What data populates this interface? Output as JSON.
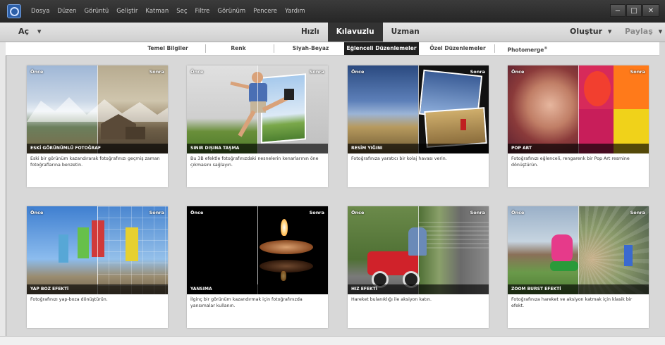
{
  "menubar": {
    "items": [
      "Dosya",
      "Düzen",
      "Görüntü",
      "Geliştir",
      "Katman",
      "Seç",
      "Filtre",
      "Görünüm",
      "Pencere",
      "Yardım"
    ],
    "window_controls": [
      "−",
      "□",
      "✕"
    ]
  },
  "modebar": {
    "open_label": "Aç",
    "modes": [
      "Hızlı",
      "Kılavuzlu",
      "Uzman"
    ],
    "active_mode": "Kılavuzlu",
    "create_label": "Oluştur",
    "share_label": "Paylaş"
  },
  "tabs": {
    "items": [
      "Temel Bilgiler",
      "Renk",
      "Siyah-Beyaz",
      "Eğlenceli Düzenlemeler",
      "Özel Düzenlemeler",
      "Photomerge"
    ],
    "active": "Eğlenceli Düzenlemeler",
    "photomerge_mark": "®"
  },
  "cards": [
    {
      "before": "Önce",
      "after": "Sonra",
      "title": "ESKİ GÖRÜNÜMLÜ FOTOĞRAF",
      "desc": "Eski bir görünüm kazandırarak fotoğrafınızı geçmiş zaman fotoğraflarına benzetin."
    },
    {
      "before": "Önce",
      "after": "Sonra",
      "title": "SINIR DIŞINA TAŞMA",
      "desc": "Bu 3B efektle fotoğrafınızdaki nesnelerin kenarlarının öne çıkmasını sağlayın."
    },
    {
      "before": "Önce",
      "after": "Sonra",
      "title": "RESİM YIĞINI",
      "desc": "Fotoğrafınıza yaratıcı bir kolaj havası verin."
    },
    {
      "before": "Önce",
      "after": "Sonra",
      "title": "POP ART",
      "desc": "Fotoğrafınızı eğlenceli, rengarenk bir Pop Art resmine dönüştürün."
    },
    {
      "before": "Önce",
      "after": "Sonra",
      "title": "YAP BOZ EFEKTİ",
      "desc": "Fotoğrafınızı yap-boza dönüştürün."
    },
    {
      "before": "Önce",
      "after": "Sonra",
      "title": "YANSIMA",
      "desc": "İlginç bir görünüm kazandırmak için fotoğrafınızda yansımalar kullanın."
    },
    {
      "before": "Önce",
      "after": "Sonra",
      "title": "HIZ EFEKTİ",
      "desc": "Hareket bulanıklığı ile aksiyon katın."
    },
    {
      "before": "Önce",
      "after": "Sonra",
      "title": "ZOOM BURST EFEKTİ",
      "desc": "Fotoğrafınıza hareket ve aksiyon katmak için klasik bir efekt."
    }
  ]
}
